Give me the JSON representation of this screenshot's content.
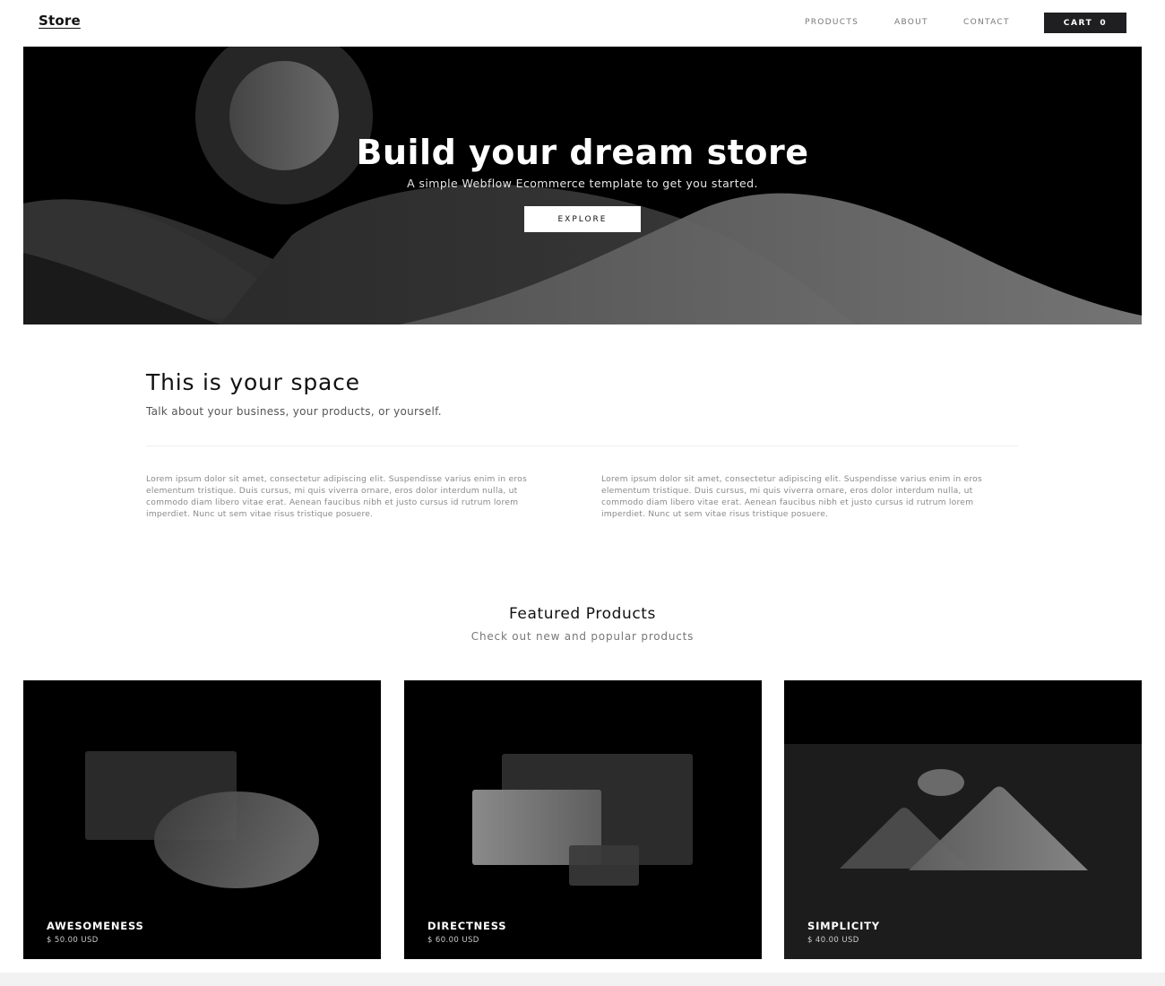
{
  "nav": {
    "brand": "Store",
    "links": [
      "PRODUCTS",
      "ABOUT",
      "CONTACT"
    ],
    "cart_label": "CART",
    "cart_count": "0"
  },
  "hero": {
    "title": "Build your dream store",
    "subtitle": "A simple Webflow Ecommerce template to get you started.",
    "button": "EXPLORE"
  },
  "about": {
    "title": "This is your space",
    "subtitle": "Talk about your business, your products, or yourself.",
    "paragraphs": [
      "Lorem ipsum dolor sit amet, consectetur adipiscing elit. Suspendisse varius enim in eros elementum tristique. Duis cursus, mi quis viverra ornare, eros dolor interdum nulla, ut commodo diam libero vitae erat. Aenean faucibus nibh et justo cursus id rutrum lorem imperdiet. Nunc ut sem vitae risus tristique posuere.",
      "Lorem ipsum dolor sit amet, consectetur adipiscing elit. Suspendisse varius enim in eros elementum tristique. Duis cursus, mi quis viverra ornare, eros dolor interdum nulla, ut commodo diam libero vitae erat. Aenean faucibus nibh et justo cursus id rutrum lorem imperdiet. Nunc ut sem vitae risus tristique posuere."
    ]
  },
  "featured": {
    "title": "Featured Products",
    "subtitle": "Check out new and popular products",
    "products": [
      {
        "name": "AWESOMENESS",
        "price": "$ 50.00 USD"
      },
      {
        "name": "DIRECTNESS",
        "price": "$ 60.00 USD"
      },
      {
        "name": "SIMPLICITY",
        "price": "$ 40.00 USD"
      }
    ]
  },
  "colors": {
    "dark": "#000000",
    "button_dark": "#1f1f22",
    "footer_strip": "#f2f2f2"
  }
}
